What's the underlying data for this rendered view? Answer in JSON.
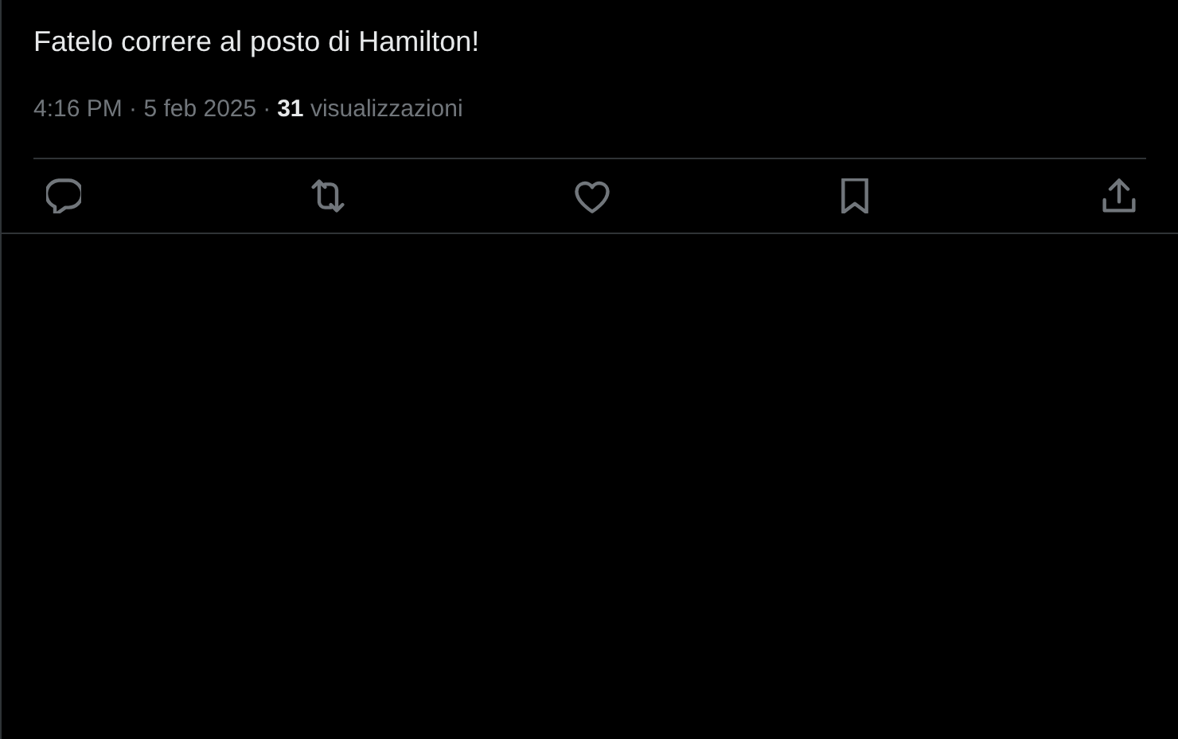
{
  "post": {
    "text": "Fatelo correre al posto di Hamilton!"
  },
  "meta": {
    "timestamp": "4:16 PM · 5 feb 2025",
    "separator": "·",
    "views": {
      "count": "31",
      "label": "visualizzazioni"
    }
  },
  "actions": [
    {
      "kind": "reply"
    },
    {
      "kind": "repost"
    },
    {
      "kind": "like"
    },
    {
      "kind": "bookmark"
    },
    {
      "kind": "share"
    }
  ]
}
